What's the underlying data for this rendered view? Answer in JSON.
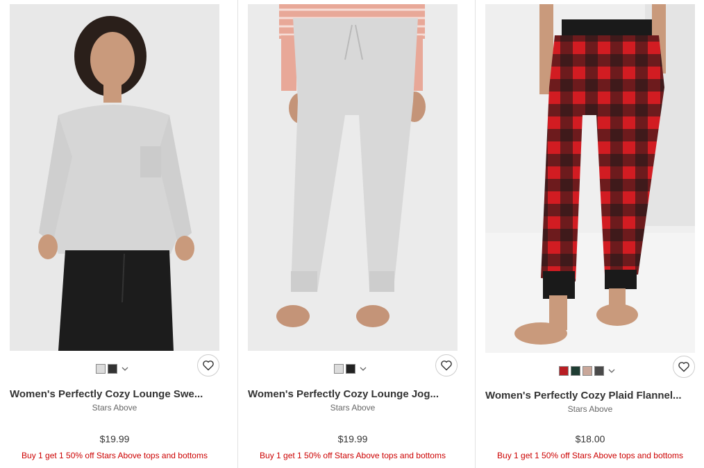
{
  "products": [
    {
      "title": "Women's Perfectly Cozy Lounge Swe...",
      "brand": "Stars Above",
      "price": "$19.99",
      "promo": "Buy 1 get 1 50% off Stars Above tops and bottoms",
      "swatch_colors": [
        "#dcdcdc",
        "#333333"
      ],
      "image_icon": "woman-in-grey-sweatshirt-photo"
    },
    {
      "title": "Women's Perfectly Cozy Lounge Jog...",
      "brand": "Stars Above",
      "price": "$19.99",
      "promo": "Buy 1 get 1 50% off Stars Above tops and bottoms",
      "swatch_colors": [
        "#dcdcdc",
        "#222222"
      ],
      "image_icon": "grey-jogger-pants-photo"
    },
    {
      "title": "Women's Perfectly Cozy Plaid Flannel...",
      "brand": "Stars Above",
      "price": "$18.00",
      "promo": "Buy 1 get 1 50% off Stars Above tops and bottoms",
      "swatch_colors": [
        "#b81e24",
        "#1f3d33",
        "#c9a79a",
        "#4a4a4a"
      ],
      "image_icon": "red-plaid-flannel-pants-photo"
    }
  ],
  "colors": {
    "promo": "#cc0000",
    "title": "#333333",
    "brand": "#666666"
  },
  "icons": {
    "favorite": "heart-icon",
    "more_swatches": "chevron-down-icon"
  }
}
